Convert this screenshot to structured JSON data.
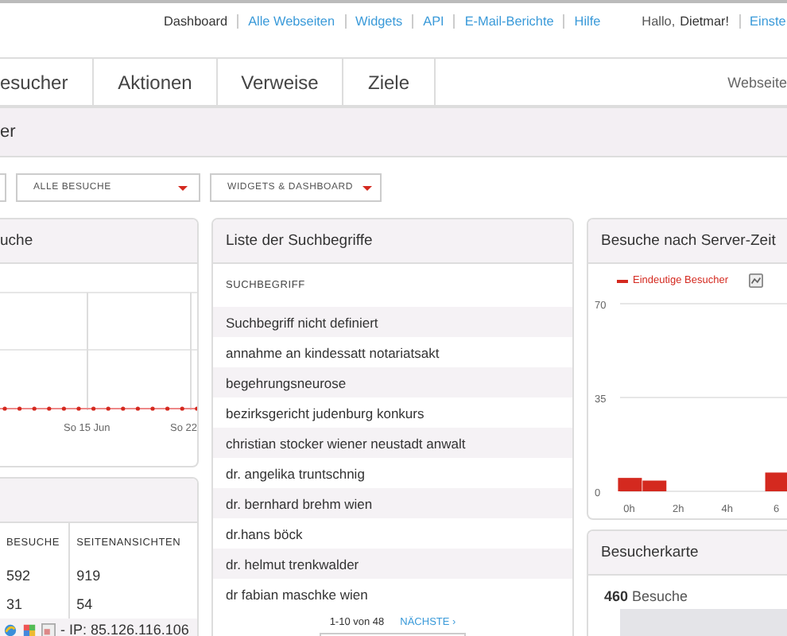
{
  "top_links": [
    {
      "label": "Dashboard",
      "selected": true
    },
    {
      "label": "Alle Webseiten",
      "selected": false
    },
    {
      "label": "Widgets",
      "selected": false
    },
    {
      "label": "API",
      "selected": false
    },
    {
      "label": "E-Mail-Berichte",
      "selected": false
    },
    {
      "label": "Hilfe",
      "selected": false
    }
  ],
  "greeting": {
    "text": "Hallo,",
    "user": "Dietmar!",
    "link": "Einste"
  },
  "nav_tabs": [
    {
      "label": "esucher",
      "selected": false
    },
    {
      "label": "Aktionen",
      "selected": false
    },
    {
      "label": "Verweise",
      "selected": false
    },
    {
      "label": "Ziele",
      "selected": false
    }
  ],
  "site_label": "Webseite",
  "subheader": "er",
  "dropdowns": [
    {
      "label": "ALLE BESUCHE"
    },
    {
      "label": "WIDGETS & DASHBOARD"
    }
  ],
  "visits_widget": {
    "title": "uche",
    "x_labels": [
      "So 15 Jun",
      "So 22"
    ]
  },
  "visitor_log": {
    "columns": [
      "BESUCHE",
      "SEITENANSICHTEN"
    ],
    "rows": [
      [
        "592",
        "919"
      ],
      [
        "31",
        "54"
      ]
    ],
    "ip": "- IP: 85.126.116.106"
  },
  "keywords": {
    "title": "Liste der Suchbegriffe",
    "column": "SUCHBEGRIFF",
    "rows": [
      "Suchbegriff nicht definiert",
      "annahme an kindessatt notariatsakt",
      "begehrungsneurose",
      "bezirksgericht judenburg konkurs",
      "christian stocker wiener neustadt anwalt",
      "dr. angelika truntschnig",
      "dr. bernhard brehm wien",
      "dr.hans böck",
      "dr. helmut trenkwalder",
      "dr fabian maschke wien"
    ],
    "pagination": "1-10 von 48",
    "next": "NÄCHSTE ›"
  },
  "server_time": {
    "title": "Besuche nach Server-Zeit",
    "chart_data": {
      "type": "bar",
      "x": [
        0,
        1,
        2,
        3,
        4,
        5,
        6
      ],
      "series": [
        {
          "name": "Eindeutige Besucher",
          "color": "#d4291f",
          "values": [
            5,
            4,
            0,
            0,
            0,
            0,
            7
          ]
        }
      ],
      "xlim": [
        -0.5,
        6.5
      ],
      "ylim": [
        0,
        70
      ],
      "yticks": [
        0,
        35,
        70
      ],
      "xticks": [
        {
          "value": 0,
          "label": "0h"
        },
        {
          "value": 2,
          "label": "2h"
        },
        {
          "value": 4,
          "label": "4h"
        },
        {
          "value": 6,
          "label": "6"
        }
      ]
    }
  },
  "map_widget": {
    "title": "Besucherkarte",
    "summary": "**460** Besuche"
  }
}
